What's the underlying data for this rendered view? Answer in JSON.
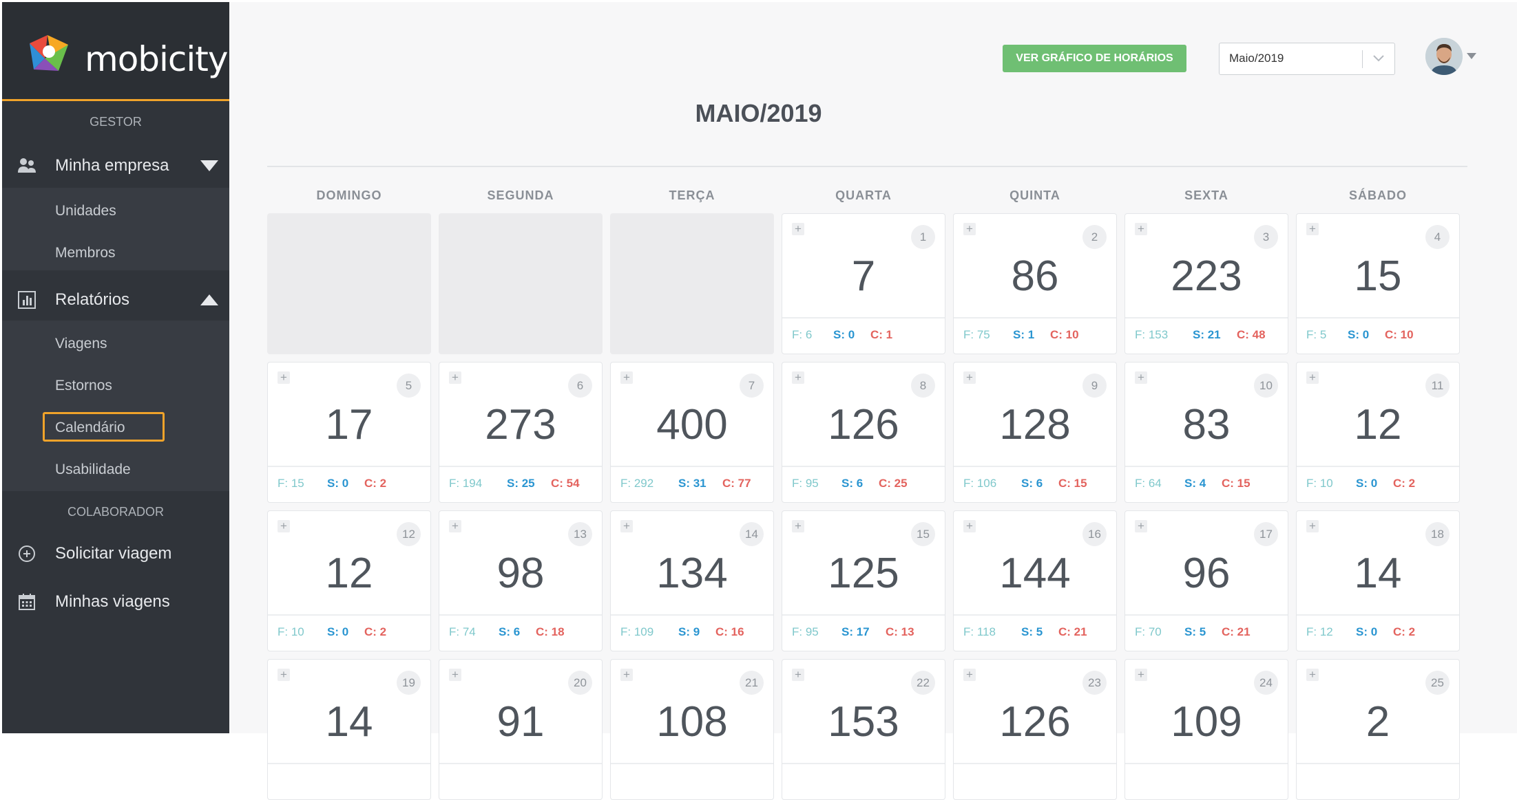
{
  "brand": "mobicity",
  "sidebar": {
    "section_gestor": "GESTOR",
    "minha_empresa": "Minha empresa",
    "empresa_items": [
      "Unidades",
      "Membros"
    ],
    "relatorios": "Relatórios",
    "relatorios_items": [
      "Viagens",
      "Estornos",
      "Calendário",
      "Usabilidade"
    ],
    "active_item": "Calendário",
    "section_colaborador": "COLABORADOR",
    "solicitar": "Solicitar viagem",
    "minhas": "Minhas viagens"
  },
  "header": {
    "graph_button": "VER GRÁFICO DE HORÁRIOS",
    "month_select_value": "Maio/2019",
    "title": "MAIO/2019"
  },
  "weekdays": [
    "DOMINGO",
    "SEGUNDA",
    "TERÇA",
    "QUARTA",
    "QUINTA",
    "SEXTA",
    "SÁBADO"
  ],
  "calendar": {
    "leading_empty": 3,
    "days": [
      {
        "day": "1",
        "total": "7",
        "f": "F: 6",
        "s": "S: 0",
        "c": "C: 1"
      },
      {
        "day": "2",
        "total": "86",
        "f": "F: 75",
        "s": "S: 1",
        "c": "C: 10"
      },
      {
        "day": "3",
        "total": "223",
        "f": "F: 153",
        "s": "S: 21",
        "c": "C: 48"
      },
      {
        "day": "4",
        "total": "15",
        "f": "F: 5",
        "s": "S: 0",
        "c": "C: 10"
      },
      {
        "day": "5",
        "total": "17",
        "f": "F: 15",
        "s": "S: 0",
        "c": "C: 2"
      },
      {
        "day": "6",
        "total": "273",
        "f": "F: 194",
        "s": "S: 25",
        "c": "C: 54"
      },
      {
        "day": "7",
        "total": "400",
        "f": "F: 292",
        "s": "S: 31",
        "c": "C: 77"
      },
      {
        "day": "8",
        "total": "126",
        "f": "F: 95",
        "s": "S: 6",
        "c": "C: 25"
      },
      {
        "day": "9",
        "total": "128",
        "f": "F: 106",
        "s": "S: 6",
        "c": "C: 15"
      },
      {
        "day": "10",
        "total": "83",
        "f": "F: 64",
        "s": "S: 4",
        "c": "C: 15"
      },
      {
        "day": "11",
        "total": "12",
        "f": "F: 10",
        "s": "S: 0",
        "c": "C: 2"
      },
      {
        "day": "12",
        "total": "12",
        "f": "F: 10",
        "s": "S: 0",
        "c": "C: 2"
      },
      {
        "day": "13",
        "total": "98",
        "f": "F: 74",
        "s": "S: 6",
        "c": "C: 18"
      },
      {
        "day": "14",
        "total": "134",
        "f": "F: 109",
        "s": "S: 9",
        "c": "C: 16"
      },
      {
        "day": "15",
        "total": "125",
        "f": "F: 95",
        "s": "S: 17",
        "c": "C: 13"
      },
      {
        "day": "16",
        "total": "144",
        "f": "F: 118",
        "s": "S: 5",
        "c": "C: 21"
      },
      {
        "day": "17",
        "total": "96",
        "f": "F: 70",
        "s": "S: 5",
        "c": "C: 21"
      },
      {
        "day": "18",
        "total": "14",
        "f": "F: 12",
        "s": "S: 0",
        "c": "C: 2"
      },
      {
        "day": "19",
        "total": "14",
        "f": "",
        "s": "",
        "c": ""
      },
      {
        "day": "20",
        "total": "91",
        "f": "",
        "s": "",
        "c": ""
      },
      {
        "day": "21",
        "total": "108",
        "f": "",
        "s": "",
        "c": ""
      },
      {
        "day": "22",
        "total": "153",
        "f": "",
        "s": "",
        "c": ""
      },
      {
        "day": "23",
        "total": "126",
        "f": "",
        "s": "",
        "c": ""
      },
      {
        "day": "24",
        "total": "109",
        "f": "",
        "s": "",
        "c": ""
      },
      {
        "day": "25",
        "total": "2",
        "f": "",
        "s": "",
        "c": ""
      }
    ]
  },
  "icons": {
    "logo": "mobicity-logo-icon",
    "users": "users-icon",
    "report": "bar-chart-icon",
    "plus_circle": "plus-circle-icon",
    "calendar": "calendar-icon"
  },
  "colors": {
    "accent": "#f0a32a",
    "button_green": "#6fbf73",
    "f_color": "#7fc8cb",
    "s_color": "#2a95d1",
    "c_color": "#e3635e"
  }
}
